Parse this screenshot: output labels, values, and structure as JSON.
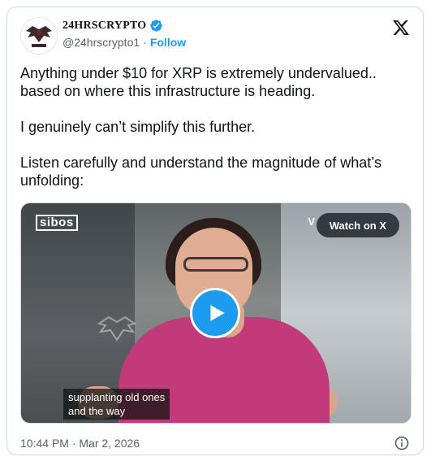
{
  "tweet": {
    "author": {
      "display_name": "24HRSCRYPTO",
      "handle": "@24hrscrypto1",
      "separator": "·",
      "follow_label": "Follow",
      "verified": true,
      "avatar_icon": "winged-logo-avatar"
    },
    "paragraphs": [
      "Anything under $10 for XRP is extremely undervalued..\nbased on where this infrastructure is heading.",
      "I genuinely can’t simplify this further.",
      "Listen carefully and understand the magnitude of what’s\nunfolding:"
    ],
    "video": {
      "brand_label": "sibos",
      "corner_letter": "V",
      "watch_label": "Watch on X",
      "caption": "supplanting old ones\nand the way",
      "play_icon": "play-icon"
    },
    "timestamp": "10:44 PM · Mar 2, 2026"
  },
  "colors": {
    "accent": "#1d9bf0",
    "text": "#0f1419",
    "muted": "#536471"
  }
}
